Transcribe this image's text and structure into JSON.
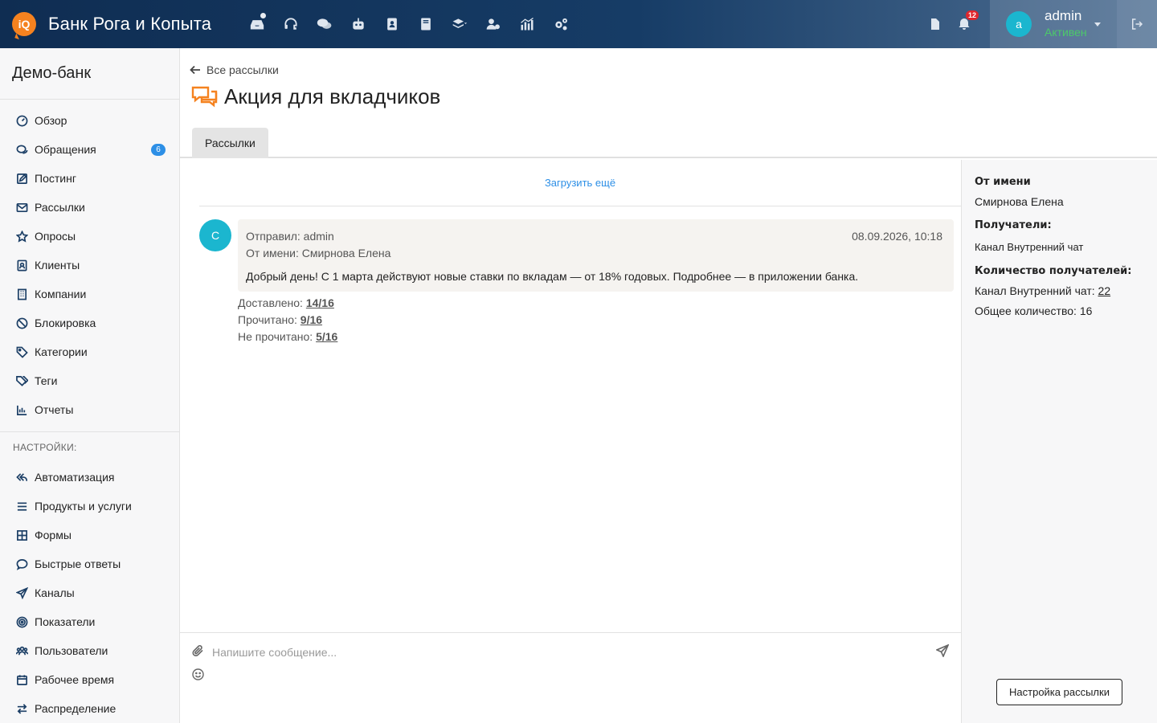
{
  "topbar": {
    "logo_text": "iQ",
    "brand": "Банк Рога и Копыта",
    "icons": [
      "inbox-icon",
      "headset-icon",
      "chat-icon",
      "robot-icon",
      "contact-book-icon",
      "book-icon",
      "layers-icon",
      "user-settings-icon",
      "analytics-icon",
      "gears-icon"
    ],
    "notifications_count": "12",
    "user_initial": "a",
    "user_name": "admin",
    "user_status": "Активен",
    "colors": {
      "accent": "#f5821f",
      "status_active": "#4cc96a",
      "badge": "#e0262d",
      "link": "#2d8fe6"
    }
  },
  "sidebar": {
    "title": "Демо-банк",
    "items": [
      {
        "label": "Обзор",
        "icon": "dashboard-icon"
      },
      {
        "label": "Обращения",
        "icon": "chat-icon",
        "badge": "6"
      },
      {
        "label": "Постинг",
        "icon": "edit-icon"
      },
      {
        "label": "Рассылки",
        "icon": "mail-icon"
      },
      {
        "label": "Опросы",
        "icon": "star-icon"
      },
      {
        "label": "Клиенты",
        "icon": "contact-icon"
      },
      {
        "label": "Компании",
        "icon": "building-icon"
      },
      {
        "label": "Блокировка",
        "icon": "ban-icon"
      },
      {
        "label": "Категории",
        "icon": "tag-icon"
      },
      {
        "label": "Теги",
        "icon": "tags-icon"
      },
      {
        "label": "Отчеты",
        "icon": "bar-chart-icon"
      }
    ],
    "section_label": "НАСТРОЙКИ:",
    "settings_items": [
      {
        "label": "Автоматизация",
        "icon": "reply-all-icon"
      },
      {
        "label": "Продукты и услуги",
        "icon": "list-icon"
      },
      {
        "label": "Формы",
        "icon": "grid-icon"
      },
      {
        "label": "Быстрые ответы",
        "icon": "comment-icon"
      },
      {
        "label": "Каналы",
        "icon": "send-icon"
      },
      {
        "label": "Показатели",
        "icon": "target-icon"
      },
      {
        "label": "Пользователи",
        "icon": "users-icon"
      },
      {
        "label": "Рабочее время",
        "icon": "calendar-icon"
      },
      {
        "label": "Распределение",
        "icon": "exchange-icon"
      }
    ]
  },
  "main": {
    "back_label": "Все рассылки",
    "title": "Акция для вкладчиков",
    "tabs": [
      {
        "label": "Рассылки",
        "active": true
      }
    ],
    "load_more": "Загрузить ещё",
    "message": {
      "avatar_initial": "С",
      "sender": "Отправил: admin",
      "date": "08.09.2026, 10:18",
      "from": "От имени: Смирнова Елена",
      "text": "Добрый день! С 1 марта действуют новые ставки по вкладам — от 18% годовых. Подробнее — в приложении банка.",
      "stats": [
        {
          "label": "Доставлено:",
          "value": "14/16"
        },
        {
          "label": "Прочитано:",
          "value": "9/16"
        },
        {
          "label": "Не прочитано:",
          "value": "5/16"
        }
      ]
    },
    "composer": {
      "placeholder": "Напишите сообщение...",
      "value": ""
    }
  },
  "right_panel": {
    "from_label": "От имени",
    "from_value": "Смирнова Елена",
    "recipients_label": "Получатели:",
    "recipients_value": "Канал Внутренний чат",
    "count_label": "Количество получателей:",
    "channel_count_label": "Канал Внутренний чат:",
    "channel_count_value": "22",
    "total_label": "Общее количество:",
    "total_value": "16",
    "settings_button": "Настройка рассылки"
  }
}
